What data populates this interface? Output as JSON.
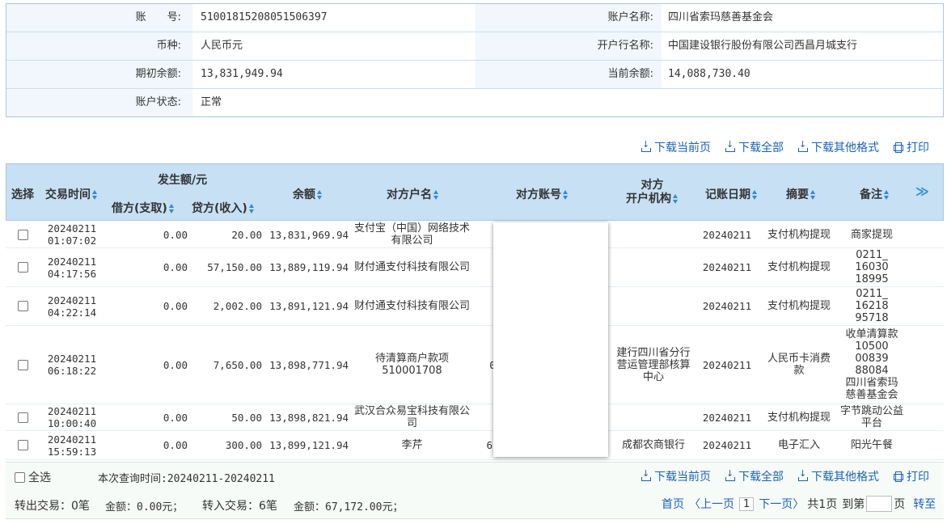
{
  "account": {
    "acct_no_label": "账　　号:",
    "acct_no": "51001815208051506397",
    "acct_name_label": "账户名称:",
    "acct_name": "四川省索玛慈善基金会",
    "currency_label": "币种:",
    "currency": "人民币元",
    "bank_label": "开户行名称:",
    "bank": "中国建设银行股份有限公司西昌月城支行",
    "opening_label": "期初余额:",
    "opening": "13,831,949.94",
    "current_label": "当前余额:",
    "current": "14,088,730.40",
    "status_label": "账户状态:",
    "status": "正常"
  },
  "actions": {
    "download_page": "下载当前页",
    "download_all": "下载全部",
    "download_other": "下载其他格式",
    "print": "打印"
  },
  "table": {
    "headers": {
      "select": "选择",
      "time": "交易时间",
      "amount_group": "发生额/元",
      "debit": "借方(支取)",
      "credit": "贷方(收入)",
      "balance": "余额",
      "cp_name": "对方户名",
      "cp_account": "对方账号",
      "cp_bank": "对方\n开户机构",
      "post_date": "记账日期",
      "summary": "摘要",
      "remark": "备注",
      "more": "≫"
    },
    "rows": [
      {
        "date": "20240211",
        "time": "01:07:02",
        "debit": "0.00",
        "credit": "20.00",
        "balance": "13,831,969.94",
        "cp_name": "支付宝（中国）网络技术有限公司",
        "cp_account": "",
        "cp_bank": "",
        "post_date": "20240211",
        "summary": "支付机构提现",
        "remark": "商家提现"
      },
      {
        "date": "20240211",
        "time": "04:17:56",
        "debit": "0.00",
        "credit": "57,150.00",
        "balance": "13,889,119.94",
        "cp_name": "财付通支付科技有限公司",
        "cp_account": "",
        "cp_bank": "",
        "post_date": "20240211",
        "summary": "支付机构提现",
        "remark": "0211_\n16030\n18995"
      },
      {
        "date": "20240211",
        "time": "04:22:14",
        "debit": "0.00",
        "credit": "2,002.00",
        "balance": "13,891,121.94",
        "cp_name": "财付通支付科技有限公司",
        "cp_account": "",
        "cp_bank": "",
        "post_date": "20240211",
        "summary": "支付机构提现",
        "remark": "0211_\n16218\n95718"
      },
      {
        "date": "20240211",
        "time": "06:18:22",
        "debit": "0.00",
        "credit": "7,650.00",
        "balance": "13,898,771.94",
        "cp_name": "待清算商户款项510001708",
        "cp_account": "0",
        "cp_bank": "建行四川省分行营运管理部核算中心",
        "post_date": "20240211",
        "summary": "人民币卡消费款",
        "remark": "收单清算款\n10500\n00839\n88084\n四川省索玛\n慈善基金会"
      },
      {
        "date": "20240211",
        "time": "10:00:40",
        "debit": "0.00",
        "credit": "50.00",
        "balance": "13,898,821.94",
        "cp_name": "武汉合众易宝科技有限公司",
        "cp_account": "",
        "cp_bank": "",
        "post_date": "20240211",
        "summary": "支付机构提现",
        "remark": "字节跳动公益平台"
      },
      {
        "date": "20240211",
        "time": "15:59:13",
        "debit": "0.00",
        "credit": "300.00",
        "balance": "13,899,121.94",
        "cp_name": "李芹",
        "cp_account": "62",
        "cp_bank": "成都农商银行",
        "post_date": "20240211",
        "summary": "电子汇入",
        "remark": "阳光午餐"
      }
    ]
  },
  "footer": {
    "select_all": "全选",
    "query_time": "本次查询时间:20240211-20240211",
    "out_count": "转出交易：0笔",
    "out_amount": "金额：0.00元；",
    "in_count": "转入交易：6笔",
    "in_amount": "金额：67,172.00元；",
    "first": "首页",
    "prev": "〈上一页",
    "page": "1",
    "next": "下一页〉",
    "total": "共1页",
    "goto_pre": "到第",
    "goto_post": "页",
    "go": "转至"
  }
}
